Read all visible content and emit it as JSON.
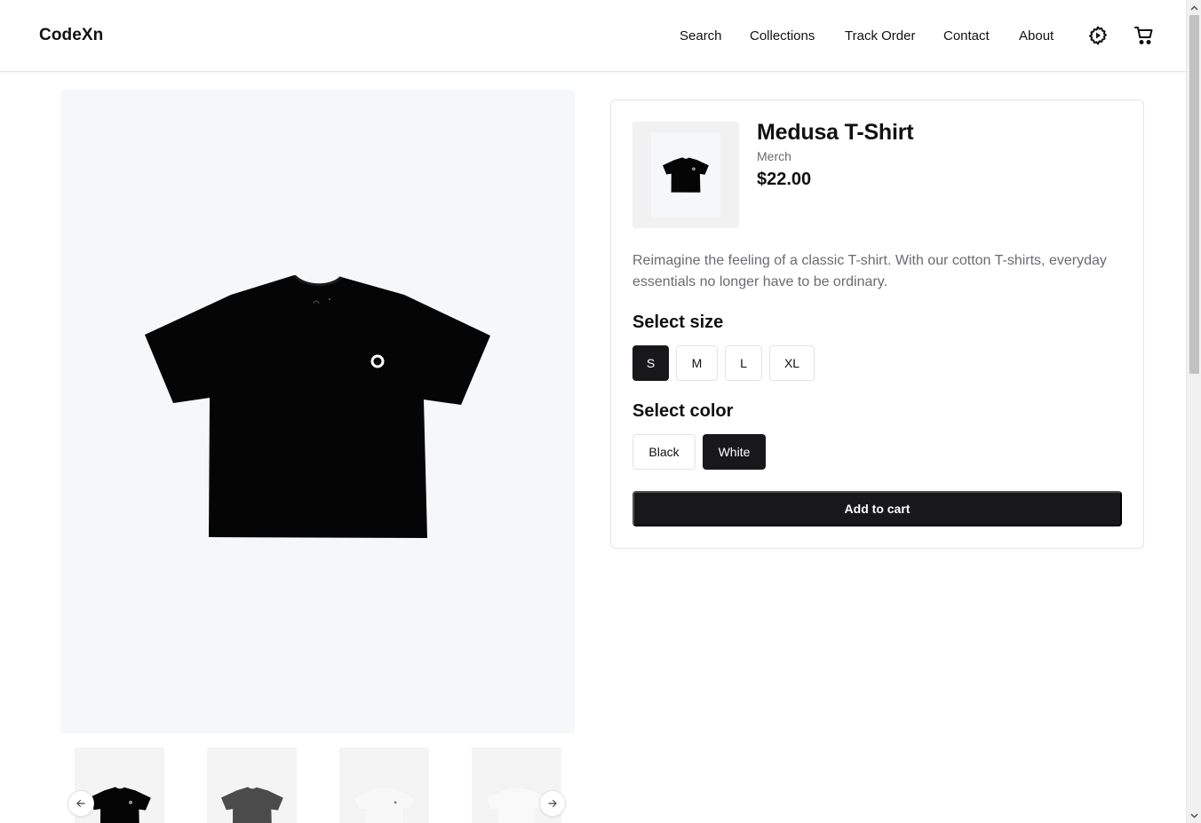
{
  "header": {
    "logo": "CodeXn",
    "nav": [
      {
        "label": "Search"
      },
      {
        "label": "Collections"
      },
      {
        "label": "Track Order"
      },
      {
        "label": "Contact"
      },
      {
        "label": "About"
      }
    ],
    "icons": [
      "settings-icon",
      "cart-icon"
    ]
  },
  "gallery": {
    "thumbnails": [
      "black",
      "gray",
      "white",
      "white"
    ],
    "prev_icon": "arrow-left-icon",
    "next_icon": "arrow-right-icon"
  },
  "product": {
    "title": "Medusa T-Shirt",
    "category": "Merch",
    "price": "$22.00",
    "description": "Reimagine the feeling of a classic T-shirt. With our cotton T-shirts, everyday essentials no longer have to be ordinary.",
    "size_heading": "Select size",
    "sizes": [
      "S",
      "M",
      "L",
      "XL"
    ],
    "selected_size": "S",
    "color_heading": "Select color",
    "colors": [
      "Black",
      "White"
    ],
    "selected_color": "White",
    "add_to_cart": "Add to cart"
  },
  "colors": {
    "primary": "#18181b",
    "muted_text": "#6b6b70",
    "image_bg": "#f6f7f9",
    "border": "#e4e4e7"
  }
}
